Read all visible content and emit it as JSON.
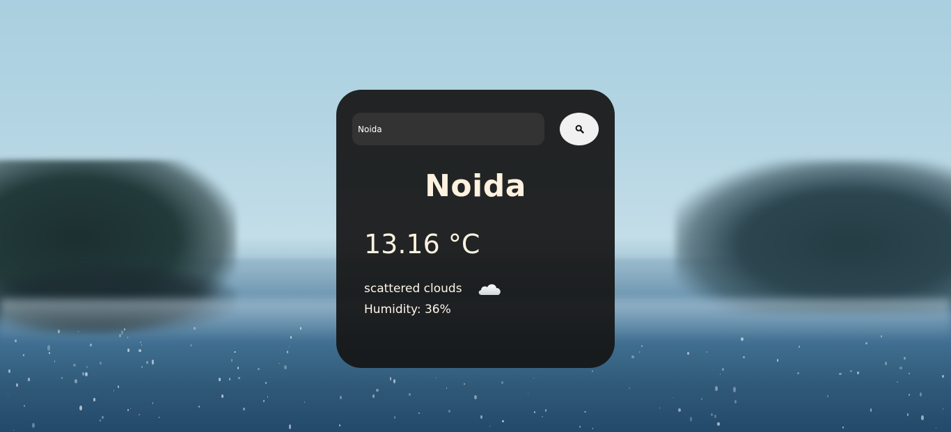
{
  "search": {
    "value": "Noida",
    "icon": "search-icon"
  },
  "weather": {
    "city": "Noida",
    "temperature": "13.16 °C",
    "description": "scattered clouds",
    "description_icon": "cloud-icon",
    "humidity": "Humidity: 36%"
  },
  "colors": {
    "card_bg": "#161616",
    "input_bg": "#333333",
    "button_bg": "#f1f1f1",
    "text": "#fff1df"
  }
}
